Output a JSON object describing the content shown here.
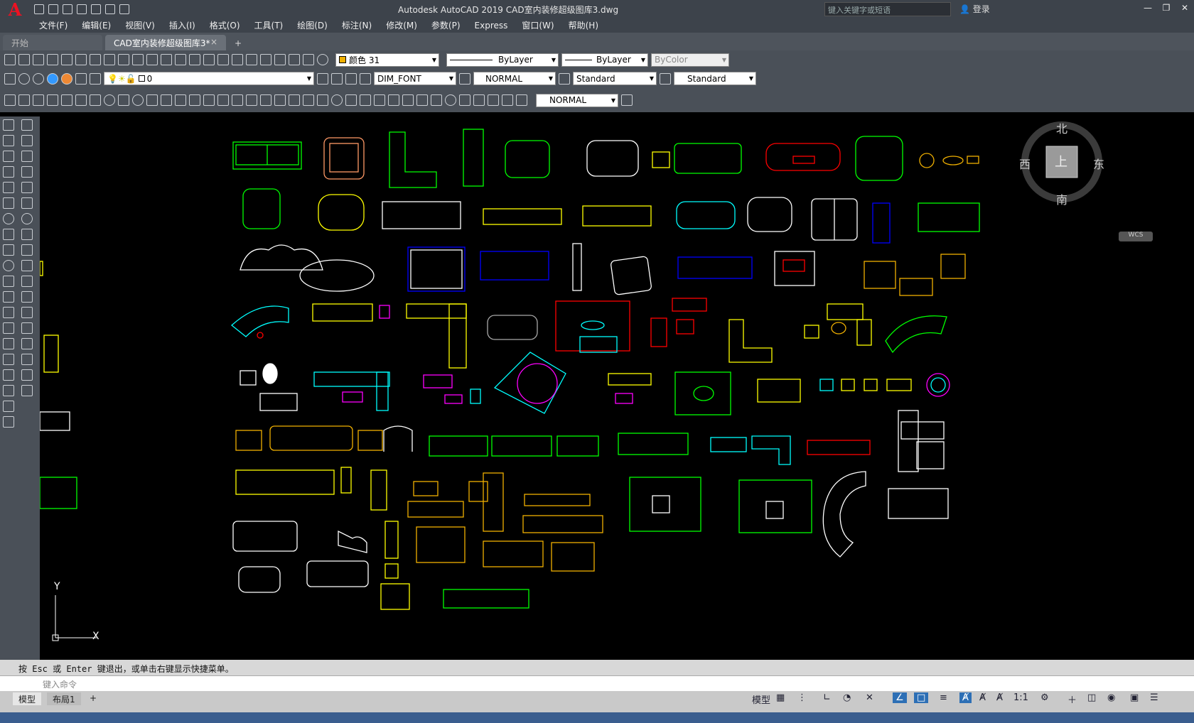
{
  "app": {
    "title": "Autodesk AutoCAD 2019    CAD室内装修超级图库3.dwg",
    "logo": "A",
    "search_placeholder": "键入关键字或短语",
    "login": "登录"
  },
  "menu": [
    "文件(F)",
    "编辑(E)",
    "视图(V)",
    "插入(I)",
    "格式(O)",
    "工具(T)",
    "绘图(D)",
    "标注(N)",
    "修改(M)",
    "参数(P)",
    "Express",
    "窗口(W)",
    "帮助(H)"
  ],
  "tabs": {
    "start": "开始",
    "file": "CAD室内装修超级图库3*",
    "plus": "+"
  },
  "toolbar1": {
    "color": "颜色 31",
    "linetype": "ByLayer",
    "lineweight": "ByLayer",
    "plotstyle": "ByColor"
  },
  "toolbar2": {
    "layer": "0",
    "textstyle": "DIM_FONT",
    "dimstyle": "NORMAL",
    "tablestyle": "Standard",
    "mleaderstyle": "Standard"
  },
  "toolbar3": {
    "dimstyle": "NORMAL"
  },
  "viewcube": {
    "north": "北",
    "south": "南",
    "east": "东",
    "west": "西",
    "face": "上",
    "wcs": "WCS"
  },
  "ucs": {
    "x": "X",
    "y": "Y"
  },
  "command": {
    "history": "按 Esc 或 Enter 键退出，或单击右键显示快捷菜单。",
    "placeholder": "键入命令"
  },
  "layout_tabs": [
    "模型",
    "布局1"
  ],
  "status": {
    "mode": "模型",
    "scale": "1:1"
  },
  "colors": {
    "green": "#00ff00",
    "yellow": "#ffff00",
    "cyan": "#00ffff",
    "magenta": "#ff00ff",
    "red": "#ff0000",
    "blue": "#0000ff",
    "white": "#ffffff",
    "orange": "#f0b000"
  }
}
